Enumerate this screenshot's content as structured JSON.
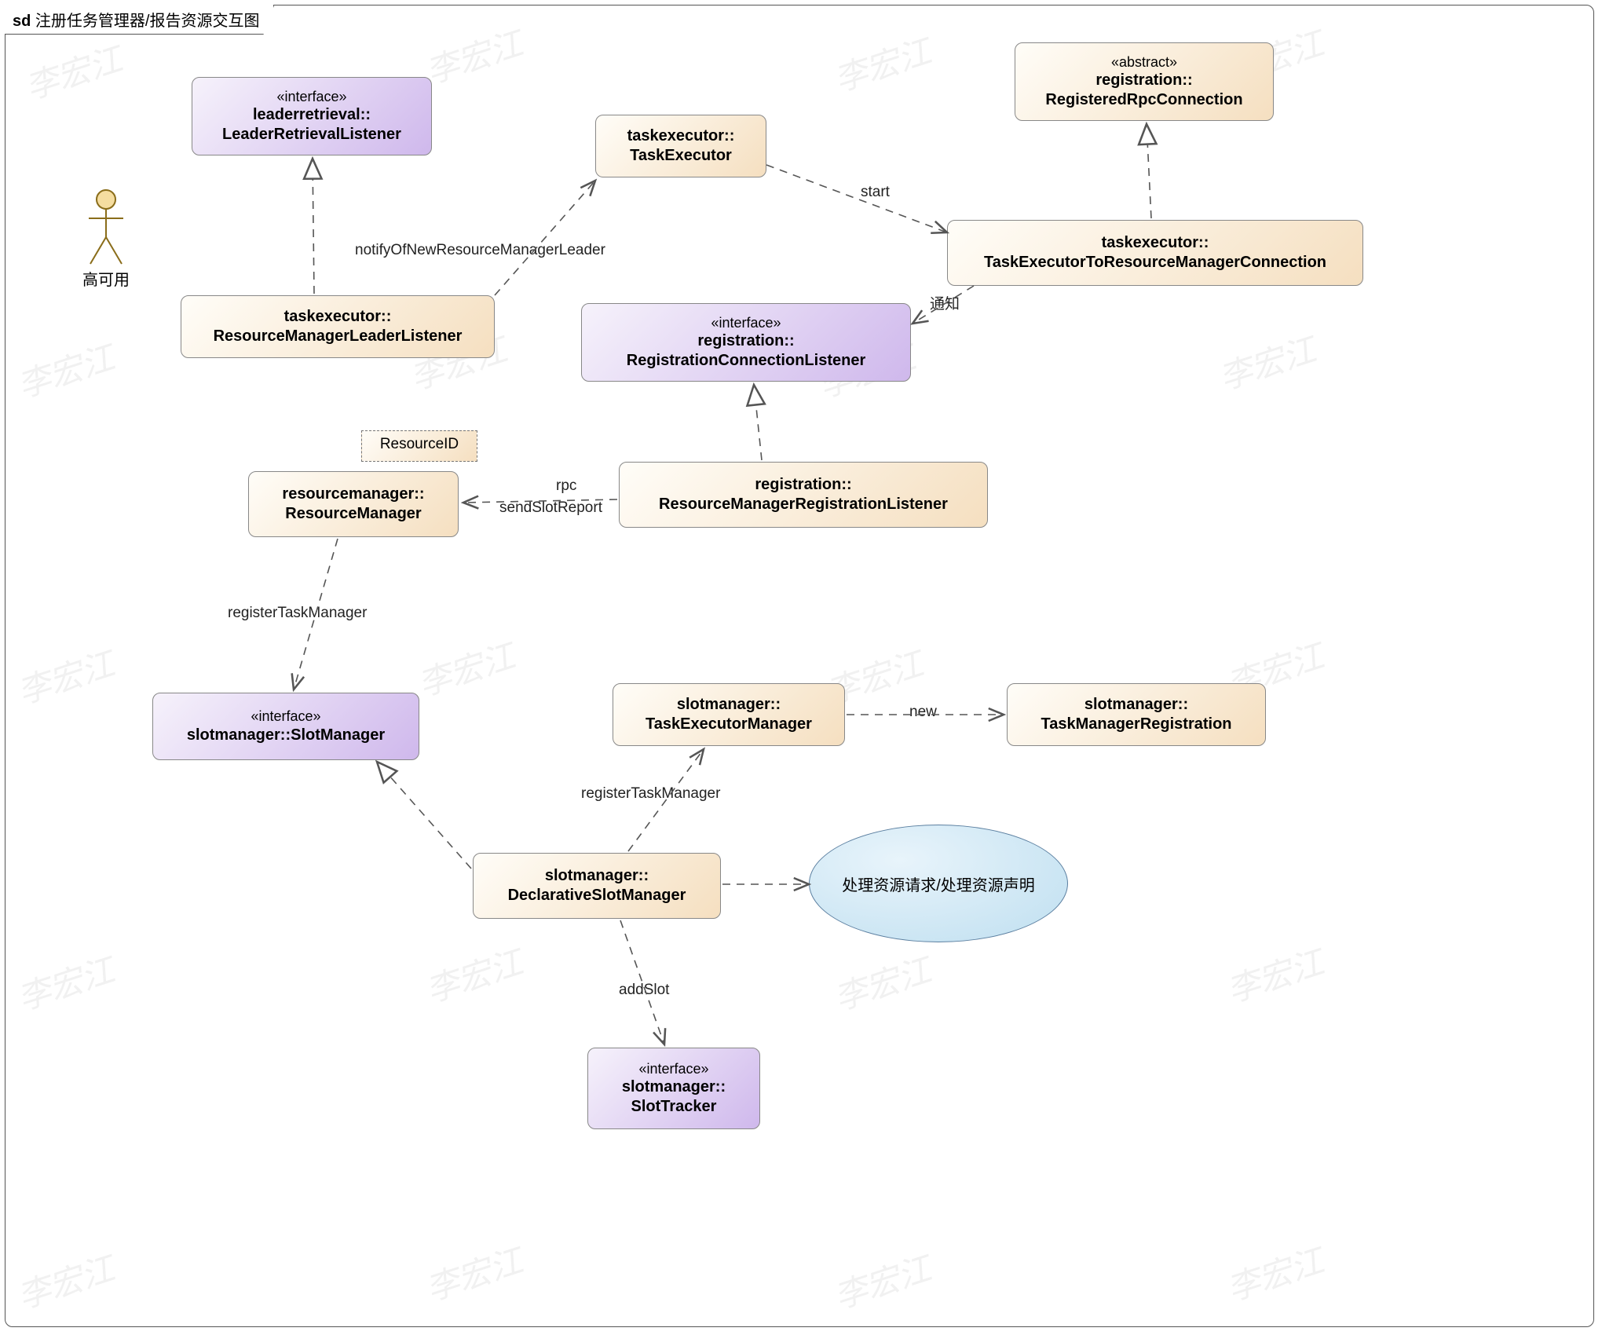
{
  "title_prefix": "sd",
  "title_rest": " 注册任务管理器/报告资源交互图",
  "actor": {
    "label": "高可用"
  },
  "nodes": {
    "leaderRetrievalListener": {
      "stereo": "«interface»",
      "name1": "leaderretrieval::",
      "name2": "LeaderRetrievalListener"
    },
    "taskExecutor": {
      "name1": "taskexecutor::",
      "name2": "TaskExecutor"
    },
    "registeredRpcConnection": {
      "stereo": "«abstract»",
      "name1": "registration::",
      "name2": "RegisteredRpcConnection"
    },
    "rmLeaderListener": {
      "name1": "taskexecutor::",
      "name2": "ResourceManagerLeaderListener"
    },
    "teToRmConnection": {
      "name1": "taskexecutor::",
      "name2": "TaskExecutorToResourceManagerConnection"
    },
    "regConnListener": {
      "stereo": "«interface»",
      "name1": "registration::",
      "name2": "RegistrationConnectionListener"
    },
    "rmRegListener": {
      "name1": "registration::",
      "name2": "ResourceManagerRegistrationListener"
    },
    "resourceManager": {
      "name1": "resourcemanager::",
      "name2": "ResourceManager"
    },
    "resourceIdNote": {
      "text": "ResourceID"
    },
    "slotManager": {
      "stereo": "«interface»",
      "name": "slotmanager::SlotManager"
    },
    "taskExecutorManager": {
      "name1": "slotmanager::",
      "name2": "TaskExecutorManager"
    },
    "tmRegistration": {
      "name1": "slotmanager::",
      "name2": "TaskManagerRegistration"
    },
    "declarativeSlotManager": {
      "name1": "slotmanager::",
      "name2": "DeclarativeSlotManager"
    },
    "slotTracker": {
      "stereo": "«interface»",
      "name1": "slotmanager::",
      "name2": "SlotTracker"
    },
    "ellipse": {
      "text": "处理资源请求/处理资源声明"
    }
  },
  "edgeLabels": {
    "notifyLeader": "notifyOfNewResourceManagerLeader",
    "start": "start",
    "notify": "通知",
    "rpc": "rpc",
    "sendSlotReport": "sendSlotReport",
    "registerTaskManager1": "registerTaskManager",
    "registerTaskManager2": "registerTaskManager",
    "new": "new",
    "addSlot": "addSlot"
  },
  "watermark": "李宏江"
}
